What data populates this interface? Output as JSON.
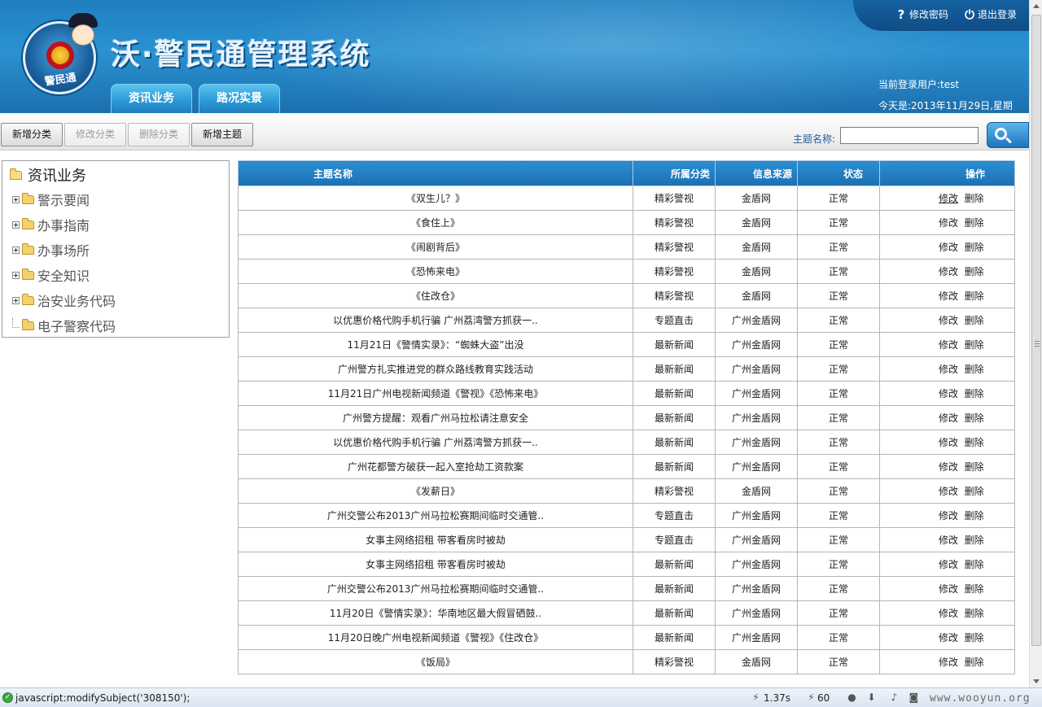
{
  "header": {
    "app_title": "沃·警民通管理系统",
    "logo_ring_text": "警民通",
    "nav_tabs": [
      "资讯业务",
      "路况实景"
    ],
    "links": {
      "change_password": "修改密码",
      "logout": "退出登录"
    },
    "current_user": "当前登录用户:test",
    "today": "今天是:2013年11月29日,星期"
  },
  "toolbar": {
    "add_category": "新增分类",
    "edit_category": "修改分类",
    "delete_category": "删除分类",
    "add_subject": "新增主题",
    "search_label": "主题名称:",
    "search_value": ""
  },
  "tree": {
    "root": "资讯业务",
    "items": [
      "警示要闻",
      "办事指南",
      "办事场所",
      "安全知识",
      "治安业务代码",
      "电子警察代码"
    ]
  },
  "table": {
    "headers": [
      "主题名称",
      "所属分类",
      "信息来源",
      "状态",
      "操作"
    ],
    "op_edit": "修改",
    "op_delete": "删除",
    "rows": [
      [
        "《双生儿？》",
        "精彩警视",
        "金盾网",
        "正常"
      ],
      [
        "《食住上》",
        "精彩警视",
        "金盾网",
        "正常"
      ],
      [
        "《闹剧背后》",
        "精彩警视",
        "金盾网",
        "正常"
      ],
      [
        "《恐怖来电》",
        "精彩警视",
        "金盾网",
        "正常"
      ],
      [
        "《住改仓》",
        "精彩警视",
        "金盾网",
        "正常"
      ],
      [
        "以优惠价格代购手机行骗 广州荔湾警方抓获一..",
        "专题直击",
        "广州金盾网",
        "正常"
      ],
      [
        "11月21日《警情实录》：“蜘蛛大盗”出没",
        "最新新闻",
        "广州金盾网",
        "正常"
      ],
      [
        "广州警方扎实推进党的群众路线教育实践活动",
        "最新新闻",
        "广州金盾网",
        "正常"
      ],
      [
        "11月21日广州电视新闻频道《警视》《恐怖来电》",
        "最新新闻",
        "广州金盾网",
        "正常"
      ],
      [
        "广州警方提醒：观看广州马拉松请注意安全",
        "最新新闻",
        "广州金盾网",
        "正常"
      ],
      [
        "以优惠价格代购手机行骗 广州荔湾警方抓获一..",
        "最新新闻",
        "广州金盾网",
        "正常"
      ],
      [
        "广州花都警方破获一起入室抢劫工资款案",
        "最新新闻",
        "广州金盾网",
        "正常"
      ],
      [
        "《发薪日》",
        "精彩警视",
        "金盾网",
        "正常"
      ],
      [
        "广州交警公布2013广州马拉松赛期间临时交通管..",
        "专题直击",
        "广州金盾网",
        "正常"
      ],
      [
        "女事主网络招租 带客看房时被劫",
        "专题直击",
        "广州金盾网",
        "正常"
      ],
      [
        "女事主网络招租 带客看房时被劫",
        "最新新闻",
        "广州金盾网",
        "正常"
      ],
      [
        "广州交警公布2013广州马拉松赛期间临时交通管..",
        "最新新闻",
        "广州金盾网",
        "正常"
      ],
      [
        "11月20日《警情实录》：华南地区最大假冒硒鼓..",
        "最新新闻",
        "广州金盾网",
        "正常"
      ],
      [
        "11月20日晚广州电视新闻频道《警视》《住改仓》",
        "最新新闻",
        "广州金盾网",
        "正常"
      ],
      [
        "《饭局》",
        "精彩警视",
        "金盾网",
        "正常"
      ]
    ]
  },
  "statusbar": {
    "text": "javascript:modifySubject('308150');",
    "time": "1.37s",
    "count": "60",
    "watermark": "www.wooyun.org"
  }
}
